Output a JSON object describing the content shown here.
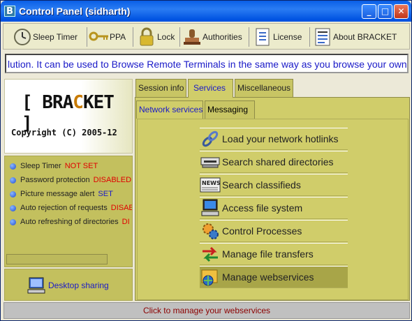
{
  "window": {
    "title": "Control Panel (sidharth)",
    "app_icon_letter": "B"
  },
  "toolbar": {
    "items": [
      {
        "label": "Sleep Timer",
        "icon": "clock-icon"
      },
      {
        "label": "PPA",
        "icon": "keys-icon"
      },
      {
        "label": "Lock",
        "icon": "padlock-icon"
      },
      {
        "label": "Authorities",
        "icon": "stamp-icon"
      },
      {
        "label": "License",
        "icon": "document-icon"
      },
      {
        "label": "About BRACKET",
        "icon": "about-document-icon"
      }
    ]
  },
  "marquee": {
    "text": "lution. It can be used to Browse Remote Terminals in the same way as you browse your own"
  },
  "left": {
    "logo_pre": "[ BRA",
    "logo_highlight": "C",
    "logo_post": "KET ]",
    "copyright": "Copyright (C) 2005-12",
    "status": [
      {
        "label": "Sleep Timer",
        "value": "NOT SET",
        "color": "#e00000"
      },
      {
        "label": "Password protection",
        "value": "DISABLED",
        "color": "#e00000"
      },
      {
        "label": "Picture message alert",
        "value": "SET",
        "color": "#1a1ac8"
      },
      {
        "label": "Auto rejection of requests",
        "value": "DISAE",
        "color": "#e00000"
      },
      {
        "label": "Auto refreshing of directories",
        "value": "DI",
        "color": "#e00000"
      }
    ],
    "desktop_sharing": "Desktop sharing"
  },
  "tabs": [
    "Session info",
    "Services",
    "Miscellaneous"
  ],
  "active_tab": "Services",
  "subtabs": [
    "Network services",
    "Messaging"
  ],
  "active_subtab": "Network services",
  "menu": [
    {
      "label": "Load your network hotlinks",
      "icon": "chain-link-icon"
    },
    {
      "label": "Search shared directories",
      "icon": "scanner-icon"
    },
    {
      "label": "Search classifieds",
      "icon": "newspaper-icon"
    },
    {
      "label": "Access file system",
      "icon": "computer-icon"
    },
    {
      "label": "Control Processes",
      "icon": "gears-icon"
    },
    {
      "label": "Manage file transfers",
      "icon": "transfer-arrows-icon"
    },
    {
      "label": "Manage webservices",
      "icon": "globe-folder-icon",
      "selected": true
    }
  ],
  "statusbar": {
    "text": "Click to manage your webservices"
  },
  "colors": {
    "panel_bg": "#d0cd6a",
    "status_bg": "#c3c05e",
    "title_bar": "#0a5fe6",
    "link_blue": "#1a1ac8",
    "alert_red": "#e00000"
  }
}
